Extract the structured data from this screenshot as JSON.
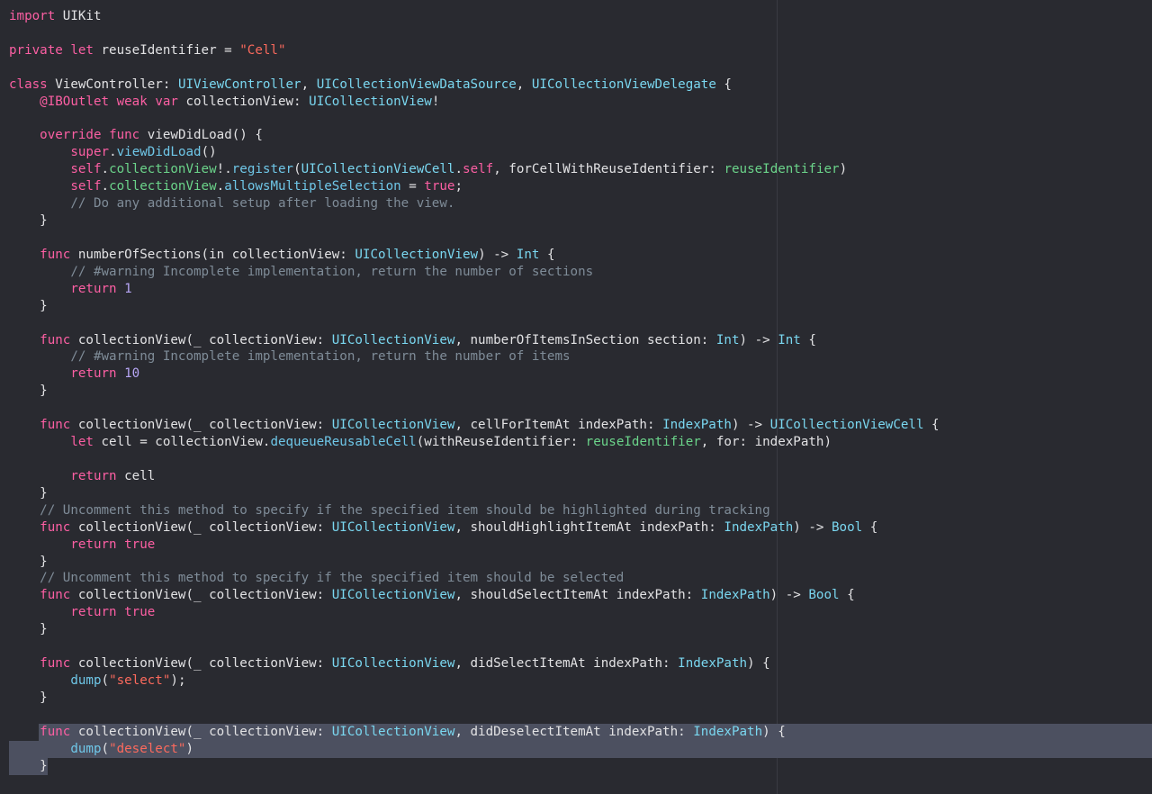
{
  "editor": {
    "selected_lines": [
      43,
      44,
      45
    ],
    "lines": [
      [
        [
          "k",
          "import"
        ],
        [
          "x",
          " UIKit"
        ]
      ],
      [],
      [
        [
          "k",
          "private"
        ],
        [
          "x",
          " "
        ],
        [
          "k",
          "let"
        ],
        [
          "x",
          " reuseIdentifier = "
        ],
        [
          "s",
          "\"Cell\""
        ]
      ],
      [],
      [
        [
          "k",
          "class"
        ],
        [
          "x",
          " ViewController: "
        ],
        [
          "t",
          "UIViewController"
        ],
        [
          "x",
          ", "
        ],
        [
          "t",
          "UICollectionViewDataSource"
        ],
        [
          "x",
          ", "
        ],
        [
          "t",
          "UICollectionViewDelegate"
        ],
        [
          "x",
          " {"
        ]
      ],
      [
        [
          "x",
          "    "
        ],
        [
          "k",
          "@IBOutlet"
        ],
        [
          "x",
          " "
        ],
        [
          "k",
          "weak"
        ],
        [
          "x",
          " "
        ],
        [
          "k",
          "var"
        ],
        [
          "x",
          " collectionView: "
        ],
        [
          "t",
          "UICollectionView"
        ],
        [
          "x",
          "!"
        ]
      ],
      [],
      [
        [
          "x",
          "    "
        ],
        [
          "k",
          "override"
        ],
        [
          "x",
          " "
        ],
        [
          "k",
          "func"
        ],
        [
          "x",
          " viewDidLoad() {"
        ]
      ],
      [
        [
          "x",
          "        "
        ],
        [
          "k",
          "super"
        ],
        [
          "x",
          "."
        ],
        [
          "m",
          "viewDidLoad"
        ],
        [
          "x",
          "()"
        ]
      ],
      [
        [
          "x",
          "        "
        ],
        [
          "k",
          "self"
        ],
        [
          "x",
          "."
        ],
        [
          "p",
          "collectionView"
        ],
        [
          "x",
          "!."
        ],
        [
          "m",
          "register"
        ],
        [
          "x",
          "("
        ],
        [
          "t",
          "UICollectionViewCell"
        ],
        [
          "x",
          "."
        ],
        [
          "k",
          "self"
        ],
        [
          "x",
          ", forCellWithReuseIdentifier: "
        ],
        [
          "p",
          "reuseIdentifier"
        ],
        [
          "x",
          ")"
        ]
      ],
      [
        [
          "x",
          "        "
        ],
        [
          "k",
          "self"
        ],
        [
          "x",
          "."
        ],
        [
          "p",
          "collectionView"
        ],
        [
          "x",
          "."
        ],
        [
          "m",
          "allowsMultipleSelection"
        ],
        [
          "x",
          " = "
        ],
        [
          "k",
          "true"
        ],
        [
          "x",
          ";"
        ]
      ],
      [
        [
          "x",
          "        "
        ],
        [
          "c",
          "// Do any additional setup after loading the view."
        ]
      ],
      [
        [
          "x",
          "    }"
        ]
      ],
      [],
      [
        [
          "x",
          "    "
        ],
        [
          "k",
          "func"
        ],
        [
          "x",
          " numberOfSections(in collectionView: "
        ],
        [
          "t",
          "UICollectionView"
        ],
        [
          "x",
          ") -> "
        ],
        [
          "t",
          "Int"
        ],
        [
          "x",
          " {"
        ]
      ],
      [
        [
          "x",
          "        "
        ],
        [
          "c",
          "// #warning Incomplete implementation, return the number of sections"
        ]
      ],
      [
        [
          "x",
          "        "
        ],
        [
          "k",
          "return"
        ],
        [
          "x",
          " "
        ],
        [
          "n",
          "1"
        ]
      ],
      [
        [
          "x",
          "    }"
        ]
      ],
      [],
      [
        [
          "x",
          "    "
        ],
        [
          "k",
          "func"
        ],
        [
          "x",
          " collectionView(_ collectionView: "
        ],
        [
          "t",
          "UICollectionView"
        ],
        [
          "x",
          ", numberOfItemsInSection section: "
        ],
        [
          "t",
          "Int"
        ],
        [
          "x",
          ") -> "
        ],
        [
          "t",
          "Int"
        ],
        [
          "x",
          " {"
        ]
      ],
      [
        [
          "x",
          "        "
        ],
        [
          "c",
          "// #warning Incomplete implementation, return the number of items"
        ]
      ],
      [
        [
          "x",
          "        "
        ],
        [
          "k",
          "return"
        ],
        [
          "x",
          " "
        ],
        [
          "n",
          "10"
        ]
      ],
      [
        [
          "x",
          "    }"
        ]
      ],
      [],
      [
        [
          "x",
          "    "
        ],
        [
          "k",
          "func"
        ],
        [
          "x",
          " collectionView(_ collectionView: "
        ],
        [
          "t",
          "UICollectionView"
        ],
        [
          "x",
          ", cellForItemAt indexPath: "
        ],
        [
          "t",
          "IndexPath"
        ],
        [
          "x",
          ") -> "
        ],
        [
          "t",
          "UICollectionViewCell"
        ],
        [
          "x",
          " {"
        ]
      ],
      [
        [
          "x",
          "        "
        ],
        [
          "k",
          "let"
        ],
        [
          "x",
          " cell = collectionView."
        ],
        [
          "m",
          "dequeueReusableCell"
        ],
        [
          "x",
          "(withReuseIdentifier: "
        ],
        [
          "p",
          "reuseIdentifier"
        ],
        [
          "x",
          ", for: indexPath)"
        ]
      ],
      [],
      [
        [
          "x",
          "        "
        ],
        [
          "k",
          "return"
        ],
        [
          "x",
          " cell"
        ]
      ],
      [
        [
          "x",
          "    }"
        ]
      ],
      [
        [
          "x",
          "    "
        ],
        [
          "c",
          "// Uncomment this method to specify if the specified item should be highlighted during tracking"
        ]
      ],
      [
        [
          "x",
          "    "
        ],
        [
          "k",
          "func"
        ],
        [
          "x",
          " collectionView(_ collectionView: "
        ],
        [
          "t",
          "UICollectionView"
        ],
        [
          "x",
          ", shouldHighlightItemAt indexPath: "
        ],
        [
          "t",
          "IndexPath"
        ],
        [
          "x",
          ") -> "
        ],
        [
          "t",
          "Bool"
        ],
        [
          "x",
          " {"
        ]
      ],
      [
        [
          "x",
          "        "
        ],
        [
          "k",
          "return"
        ],
        [
          "x",
          " "
        ],
        [
          "k",
          "true"
        ]
      ],
      [
        [
          "x",
          "    }"
        ]
      ],
      [
        [
          "x",
          "    "
        ],
        [
          "c",
          "// Uncomment this method to specify if the specified item should be selected"
        ]
      ],
      [
        [
          "x",
          "    "
        ],
        [
          "k",
          "func"
        ],
        [
          "x",
          " collectionView(_ collectionView: "
        ],
        [
          "t",
          "UICollectionView"
        ],
        [
          "x",
          ", shouldSelectItemAt indexPath: "
        ],
        [
          "t",
          "IndexPath"
        ],
        [
          "x",
          ") -> "
        ],
        [
          "t",
          "Bool"
        ],
        [
          "x",
          " {"
        ]
      ],
      [
        [
          "x",
          "        "
        ],
        [
          "k",
          "return"
        ],
        [
          "x",
          " "
        ],
        [
          "k",
          "true"
        ]
      ],
      [
        [
          "x",
          "    }"
        ]
      ],
      [],
      [
        [
          "x",
          "    "
        ],
        [
          "k",
          "func"
        ],
        [
          "x",
          " collectionView(_ collectionView: "
        ],
        [
          "t",
          "UICollectionView"
        ],
        [
          "x",
          ", didSelectItemAt indexPath: "
        ],
        [
          "t",
          "IndexPath"
        ],
        [
          "x",
          ") {"
        ]
      ],
      [
        [
          "x",
          "        "
        ],
        [
          "m",
          "dump"
        ],
        [
          "x",
          "("
        ],
        [
          "s",
          "\"select\""
        ],
        [
          "x",
          ");"
        ]
      ],
      [
        [
          "x",
          "    }"
        ]
      ],
      [],
      [
        [
          "x",
          "    "
        ],
        [
          "k",
          "func"
        ],
        [
          "x",
          " collectionView(_ collectionView: "
        ],
        [
          "t",
          "UICollectionView"
        ],
        [
          "x",
          ", didDeselectItemAt indexPath: "
        ],
        [
          "t",
          "IndexPath"
        ],
        [
          "x",
          ") {"
        ]
      ],
      [
        [
          "x",
          "        "
        ],
        [
          "m",
          "dump"
        ],
        [
          "x",
          "("
        ],
        [
          "s",
          "\"deselect\""
        ],
        [
          "x",
          ")"
        ]
      ],
      [
        [
          "x",
          "    }"
        ]
      ]
    ]
  }
}
